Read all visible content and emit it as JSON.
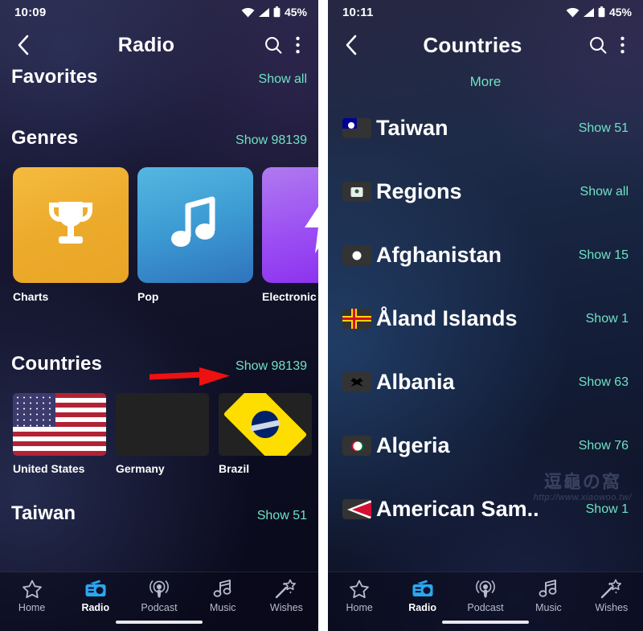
{
  "left": {
    "status": {
      "clock": "10:09",
      "battery": "45%",
      "icons": [
        "wifi-icon",
        "cellular-signal-icon",
        "battery-icon"
      ]
    },
    "appbar": {
      "title": "Radio",
      "back": "back-arrow-icon",
      "search": "search-icon",
      "menu": "kebab-menu-icon"
    },
    "sections": [
      {
        "title": "Favorites",
        "link": "Show all"
      },
      {
        "title": "Genres",
        "link": "Show 98139"
      },
      {
        "title": "Countries",
        "link": "Show 98139"
      },
      {
        "title": "Taiwan",
        "link": "Show 51"
      }
    ],
    "genres": [
      {
        "label": "Charts",
        "icon": "trophy-icon",
        "color": "#edab2c"
      },
      {
        "label": "Pop",
        "icon": "music-note-icon",
        "color": "#3e9ed4"
      },
      {
        "label": "Electronic",
        "icon": "lightning-bolt-icon",
        "color": "#9b4ef2"
      }
    ],
    "countries": [
      {
        "label": "United States",
        "flag": "flag-us"
      },
      {
        "label": "Germany",
        "flag": "flag-de"
      },
      {
        "label": "Brazil",
        "flag": "flag-br"
      },
      {
        "label": "",
        "flag": "flag-fr"
      }
    ],
    "annotation": {
      "type": "red-arrow",
      "color": "#ee1111",
      "points_to": "Show 98139"
    }
  },
  "right": {
    "status": {
      "clock": "10:11",
      "battery": "45%"
    },
    "appbar": {
      "title": "Countries"
    },
    "more_label": "More",
    "rows": [
      {
        "name": "Taiwan",
        "count": "Show 51",
        "flag": "flag-tw"
      },
      {
        "name": "Regions",
        "count": "Show all",
        "flag": "regions-map-icon"
      },
      {
        "name": "Afghanistan",
        "count": "Show 15",
        "flag": "flag-af"
      },
      {
        "name": "Åland Islands",
        "count": "Show 1",
        "flag": "flag-ax"
      },
      {
        "name": "Albania",
        "count": "Show 63",
        "flag": "flag-al"
      },
      {
        "name": "Algeria",
        "count": "Show 76",
        "flag": "flag-dz"
      },
      {
        "name": "American Sam..",
        "count": "Show 1",
        "flag": "flag-as"
      }
    ],
    "watermark": {
      "cjk": "逗龜の窩",
      "url": "http://www.xiaowoo.tw/"
    }
  },
  "nav": {
    "items": [
      {
        "label": "Home",
        "icon": "star-icon",
        "active": false
      },
      {
        "label": "Radio",
        "icon": "radio-icon",
        "active": true
      },
      {
        "label": "Podcast",
        "icon": "podcast-icon",
        "active": false
      },
      {
        "label": "Music",
        "icon": "music-notes-icon",
        "active": false
      },
      {
        "label": "Wishes",
        "icon": "magic-wand-icon",
        "active": false
      }
    ]
  },
  "colors": {
    "accent_link": "#6fe3c4",
    "nav_active": "#2aa8ef",
    "arrow": "#ee1111"
  }
}
